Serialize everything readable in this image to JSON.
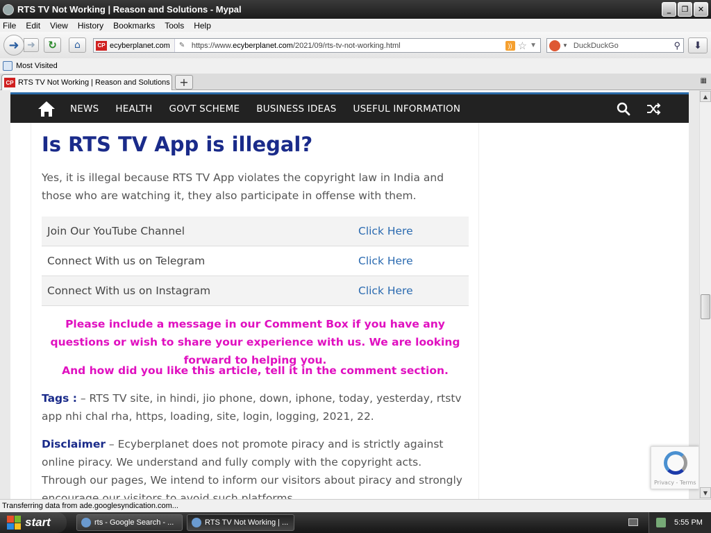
{
  "window": {
    "title": "RTS TV Not Working | Reason and Solutions - Mypal",
    "buttons": {
      "minimize": "_",
      "maximize": "❐",
      "close": "✕"
    }
  },
  "menu": [
    "File",
    "Edit",
    "View",
    "History",
    "Bookmarks",
    "Tools",
    "Help"
  ],
  "navbar": {
    "site_identity": "ecyberplanet.com",
    "url_prefix": "https://www.",
    "url_domain": "ecyberplanet.com",
    "url_path": "/2021/09/rts-tv-not-working.html",
    "search_placeholder": "DuckDuckGo"
  },
  "bookmarks": {
    "most_visited": "Most Visited"
  },
  "tabs": [
    {
      "label": "RTS TV Not Working | Reason and Solutions"
    }
  ],
  "site_nav": {
    "items": [
      "NEWS",
      "HEALTH",
      "GOVT SCHEME",
      "BUSINESS IDEAS",
      "USEFUL INFORMATION"
    ]
  },
  "article": {
    "heading": "Is RTS TV App is illegal?",
    "paragraph": "Yes, it is illegal because RTS TV App violates the copyright law in India and those who are watching it, they also participate in offense with them.",
    "links": [
      {
        "label": "Join Our YouTube Channel",
        "link": "Click Here"
      },
      {
        "label": "Connect With us on Telegram",
        "link": "Click Here"
      },
      {
        "label": "Connect With us on Instagram",
        "link": "Click Here"
      }
    ],
    "notice": "Please include a message in our Comment Box if you have any questions or wish to share your experience with us. We are looking forward to helping you.",
    "notice2": "And how did you like this article, tell it in the comment section.",
    "tags_key": "Tags :",
    "tags_text": " – RTS TV site, in hindi, jio phone, down, iphone, today, yesterday, rtstv app nhi chal rha, https, loading, site, login, logging, 2021, 22.",
    "disclaimer_key": "Disclaimer",
    "disclaimer_text": " – Ecyberplanet does not promote piracy and is strictly against online piracy. We understand and fully comply with the copyright acts. Through our pages, We intend to inform our visitors about piracy and strongly encourage our visitors to avoid such platforms."
  },
  "recaptcha": {
    "terms": "Privacy - Terms"
  },
  "status": "Transferring data from ade.googlesyndication.com...",
  "taskbar": {
    "start": "start",
    "items": [
      "rts - Google Search - ...",
      "RTS TV Not Working | ..."
    ],
    "clock": "5:55 PM"
  },
  "colors": {
    "heading": "#1a2b8a",
    "link": "#2a6ab0",
    "notice": "#e010c0",
    "nav_bg": "#222222",
    "nav_accent": "#2a6aa8"
  }
}
